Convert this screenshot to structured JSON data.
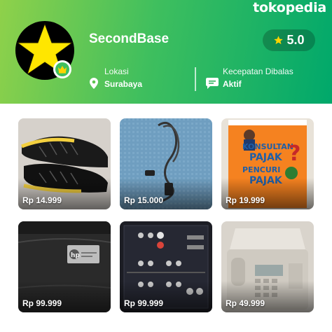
{
  "brand": "tokopedia",
  "shop": {
    "name": "SecondBase",
    "rating": "5.0",
    "location_label": "Lokasi",
    "location_value": "Surabaya",
    "response_label": "Kecepatan Dibalas",
    "response_value": "Aktif"
  },
  "products": [
    {
      "price": "Rp 14.999",
      "image": "black-yellow-sneakers"
    },
    {
      "price": "Rp 15.000",
      "image": "grey-power-cable"
    },
    {
      "price": "Rp 19.999",
      "image": "book-cover"
    },
    {
      "price": "Rp 99.999",
      "image": "hp-laptop-bag"
    },
    {
      "price": "Rp 99.999",
      "image": "av-receiver-back-panel"
    },
    {
      "price": "Rp 49.999",
      "image": "fax-machine"
    }
  ],
  "book_cover_text": {
    "line1": "KONSULTAN",
    "line2": "PAJAK",
    "line3": "PENCURI",
    "line4": "PAJAK"
  },
  "hp_logo_text": "hp",
  "colors": {
    "header_start": "#8fd14a",
    "header_end": "#00a86b",
    "star": "#ffd400"
  }
}
